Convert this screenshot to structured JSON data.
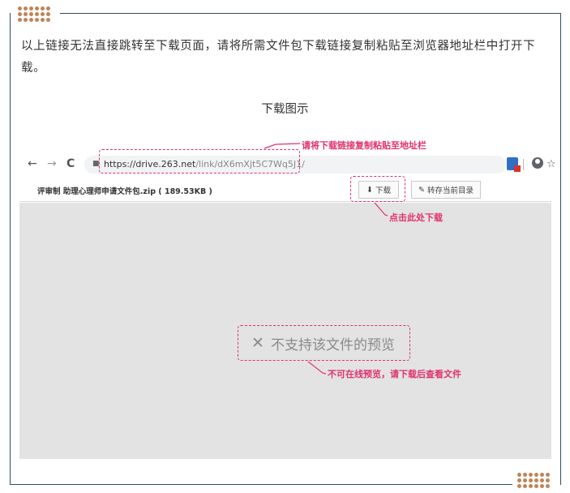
{
  "intro_text": "以上链接无法直接跳转至下载页面，请将所需文件包下载链接复制粘贴至浏览器地址栏中打开下载。",
  "caption": "下载图示",
  "browser": {
    "back_icon": "←",
    "forward_icon": "→",
    "reload_icon": "C",
    "lock_icon": "lock-icon",
    "url_main": "https://drive.263.net",
    "url_path": "/link/dX6mXjt5C7Wq5J1/",
    "star_icon": "☆"
  },
  "file": {
    "name": "评审制 助理心理师申请文件包.zip ( 189.53KB )",
    "download_label": "下载",
    "save_label": "转存当前目录"
  },
  "preview": {
    "message": "不支持该文件的预览",
    "close_icon": "✕"
  },
  "annotations": {
    "copy_url": "请将下载链接复制粘贴至地址栏",
    "click_download": "点击此处下载",
    "no_preview": "不可在线预览，请下载后查看文件"
  },
  "colors": {
    "accent": "#e0336b",
    "frame": "#2f4f5a",
    "dots": "#c08457",
    "preview_bg": "#e3e3e3"
  }
}
